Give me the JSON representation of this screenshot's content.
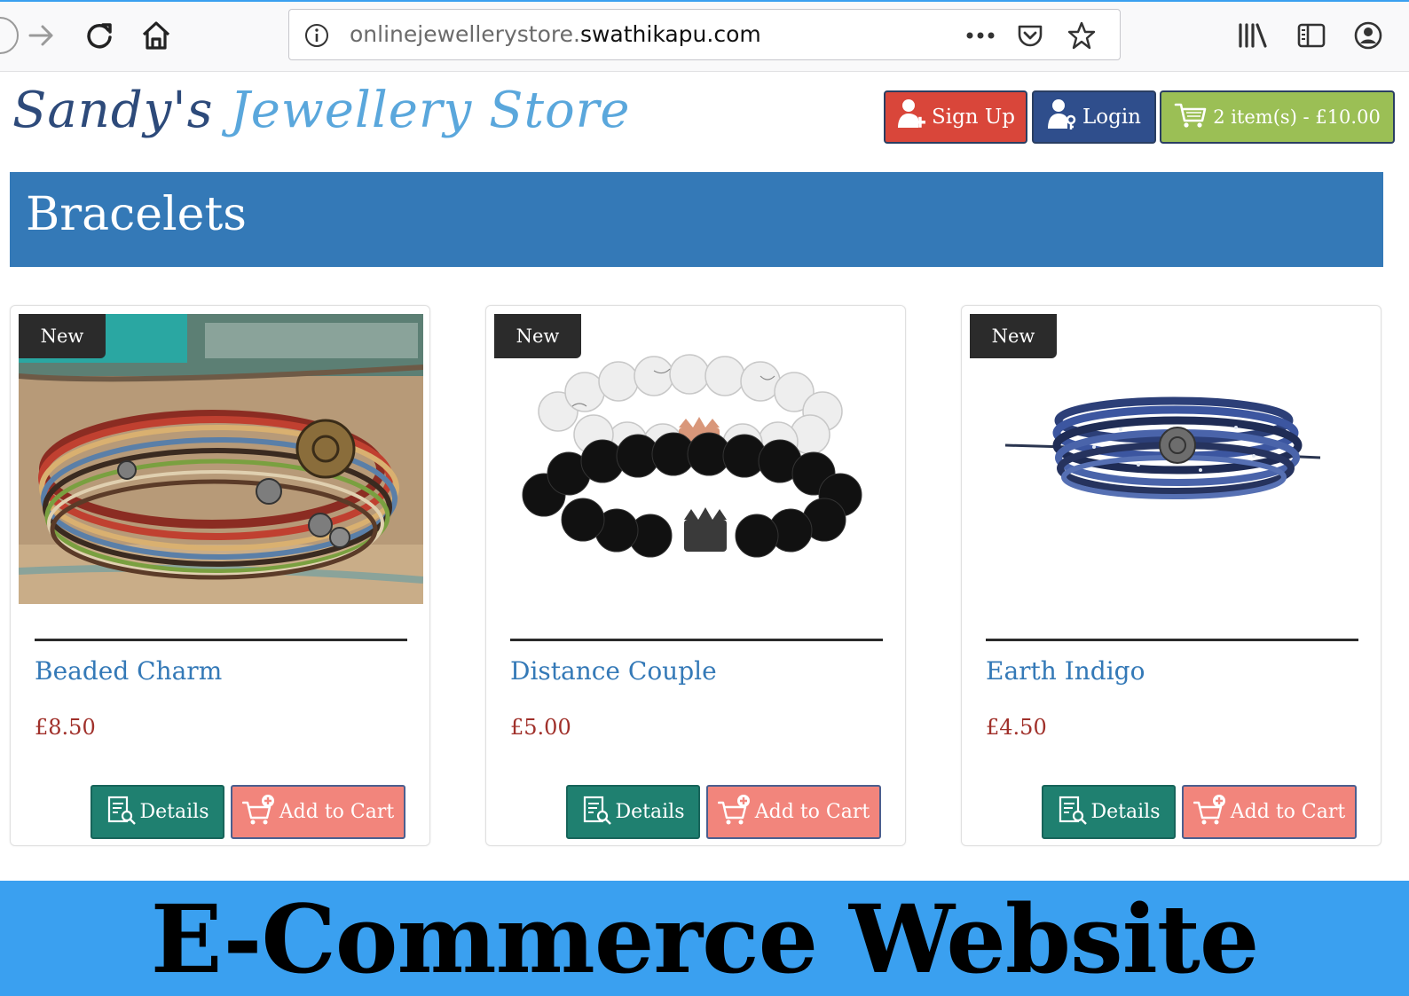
{
  "browser": {
    "url_prefix": "onlinejewellerystore.",
    "url_host": "swathikapu.com",
    "icons": [
      "back-icon",
      "forward-icon",
      "reload-icon",
      "home-icon",
      "info-icon",
      "more-icon",
      "pocket-icon",
      "bookmark-star-icon",
      "library-icon",
      "sidebar-icon",
      "account-icon"
    ]
  },
  "header": {
    "logo_part1": "Sandy's",
    "logo_part2": "Jewellery Store",
    "signup_label": "Sign Up",
    "login_label": "Login",
    "cart_label": "2 item(s) - £10.00"
  },
  "category": {
    "title": "Bracelets"
  },
  "products": [
    {
      "badge": "New",
      "name": "Beaded Charm",
      "price": "£8.50",
      "details_label": "Details",
      "add_label": "Add to Cart"
    },
    {
      "badge": "New",
      "name": "Distance Couple",
      "price": "£5.00",
      "details_label": "Details",
      "add_label": "Add to Cart"
    },
    {
      "badge": "New",
      "name": "Earth Indigo",
      "price": "£4.50",
      "details_label": "Details",
      "add_label": "Add to Cart"
    }
  ],
  "caption": "E-Commerce Website",
  "colors": {
    "banner": "#3479b7",
    "signup": "#d9463a",
    "login": "#2f4e8c",
    "cart": "#9bbf55",
    "details": "#1f8070",
    "add_to_cart": "#f2857c",
    "caption_bg": "#3aa0f0"
  }
}
